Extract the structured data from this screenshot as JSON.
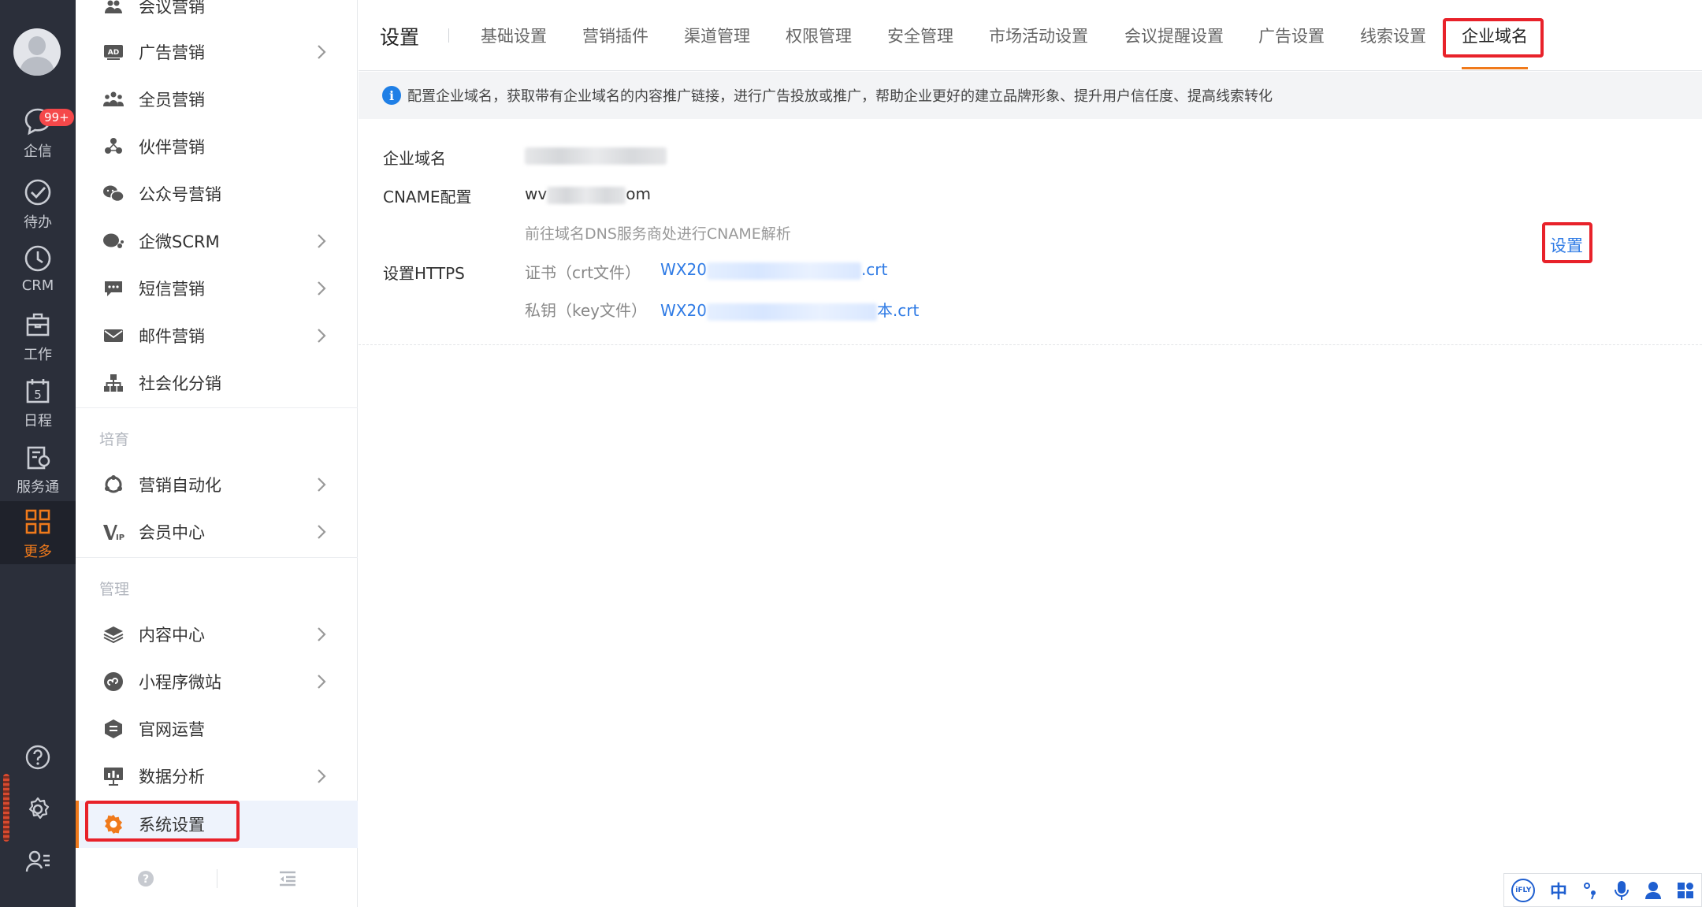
{
  "rail": {
    "badge": "99+",
    "items": [
      {
        "label": "企信",
        "icon": "chat-bubble-icon"
      },
      {
        "label": "待办",
        "icon": "check-circle-icon"
      },
      {
        "label": "CRM",
        "icon": "clock-icon"
      },
      {
        "label": "工作",
        "icon": "briefcase-icon"
      },
      {
        "label": "日程",
        "icon": "calendar-icon",
        "day": "5"
      },
      {
        "label": "服务通",
        "icon": "service-icon"
      },
      {
        "label": "更多",
        "icon": "grid-icon"
      }
    ],
    "accent": "#f07a1b"
  },
  "sidebar": {
    "items": [
      {
        "label": "会议营销",
        "icon": "meeting-icon"
      },
      {
        "label": "广告营销",
        "icon": "ad-icon",
        "chevron": true
      },
      {
        "label": "全员营销",
        "icon": "team-icon"
      },
      {
        "label": "伙伴营销",
        "icon": "partner-icon"
      },
      {
        "label": "公众号营销",
        "icon": "wechat-icon"
      },
      {
        "label": "企微SCRM",
        "icon": "wecom-icon",
        "chevron": true
      },
      {
        "label": "短信营销",
        "icon": "sms-icon",
        "chevron": true
      },
      {
        "label": "邮件营销",
        "icon": "mail-icon",
        "chevron": true
      },
      {
        "label": "社会化分销",
        "icon": "org-chart-icon"
      },
      {
        "label": "营销自动化",
        "icon": "automation-icon",
        "chevron": true
      },
      {
        "label": "会员中心",
        "icon": "vip-icon",
        "chevron": true
      },
      {
        "label": "内容中心",
        "icon": "layers-icon",
        "chevron": true
      },
      {
        "label": "小程序微站",
        "icon": "miniprogram-icon",
        "chevron": true
      },
      {
        "label": "官网运营",
        "icon": "website-icon"
      },
      {
        "label": "数据分析",
        "icon": "chart-icon",
        "chevron": true
      },
      {
        "label": "系统设置",
        "icon": "settings-gear-icon",
        "selected": true
      }
    ],
    "groups": {
      "nurture": "培育",
      "manage": "管理"
    }
  },
  "tabs": {
    "title": "设置",
    "items": [
      "基础设置",
      "营销插件",
      "渠道管理",
      "权限管理",
      "安全管理",
      "市场活动设置",
      "会议提醒设置",
      "广告设置",
      "线索设置",
      "企业域名"
    ],
    "active": "企业域名"
  },
  "notice": {
    "text": "配置企业域名，获取带有企业域名的内容推广链接，进行广告投放或推广，帮助企业更好的建立品牌形象、提升用户信任度、提高线索转化"
  },
  "form": {
    "domain_label": "企业域名",
    "cname_label": "CNAME配置",
    "cname_prefix": "wv",
    "cname_suffix": "om",
    "cname_hint": "前往域名DNS服务商处进行CNAME解析",
    "https_label": "设置HTTPS",
    "cert_label": "证书（crt文件）",
    "cert_prefix": "WX20",
    "cert_suffix": ".crt",
    "key_label": "私钥（key文件）",
    "key_prefix": "WX20",
    "key_suffix": "本.crt",
    "set_link": "设置"
  },
  "ime": {
    "lang": "中",
    "brand": "iFLY"
  }
}
